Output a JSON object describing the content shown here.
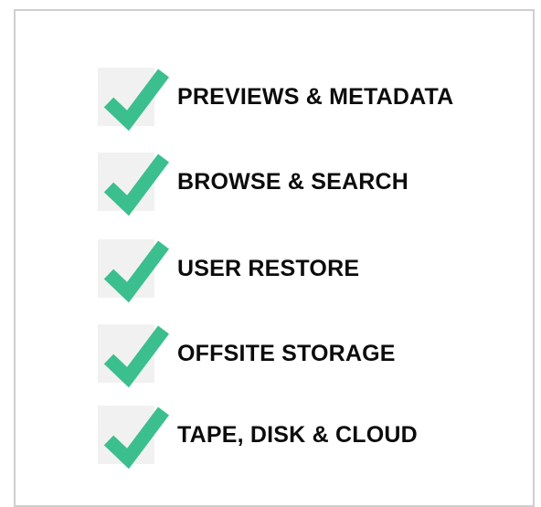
{
  "colors": {
    "check": "#3bbf8e",
    "check_bg": "#f1f1f1",
    "text": "#0c0c0c",
    "border": "#cfcfcf"
  },
  "features": [
    {
      "label": "PREVIEWS & METADATA",
      "icon": "check-icon"
    },
    {
      "label": "BROWSE & SEARCH",
      "icon": "check-icon"
    },
    {
      "label": "USER RESTORE",
      "icon": "check-icon"
    },
    {
      "label": "OFFSITE STORAGE",
      "icon": "check-icon"
    },
    {
      "label": "TAPE, DISK & CLOUD",
      "icon": "check-icon"
    }
  ]
}
